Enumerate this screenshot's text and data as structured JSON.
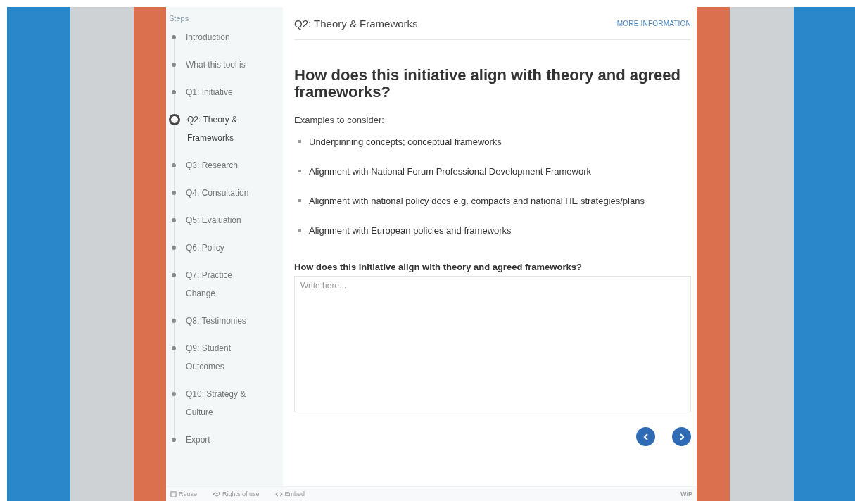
{
  "sidebar": {
    "title": "Steps",
    "steps": [
      {
        "label": "Introduction",
        "selected": false
      },
      {
        "label": "What this tool is",
        "selected": false
      },
      {
        "label": "Q1: Initiative",
        "selected": false
      },
      {
        "label": "Q2: Theory & Frameworks",
        "selected": true
      },
      {
        "label": "Q3: Research",
        "selected": false
      },
      {
        "label": "Q4: Consultation",
        "selected": false
      },
      {
        "label": "Q5: Evaluation",
        "selected": false
      },
      {
        "label": "Q6: Policy",
        "selected": false
      },
      {
        "label": "Q7: Practice Change",
        "selected": false
      },
      {
        "label": "Q8: Testimonies",
        "selected": false
      },
      {
        "label": "Q9: Student Outcomes",
        "selected": false
      },
      {
        "label": "Q10: Strategy & Culture",
        "selected": false
      },
      {
        "label": "Export",
        "selected": false
      }
    ]
  },
  "header": {
    "title": "Q2: Theory & Frameworks",
    "link": "MORE INFORMATION"
  },
  "question": "How does this initiative align with theory and agreed frameworks?",
  "intro": "Examples to consider:",
  "examples": [
    "Underpinning concepts; conceptual frameworks",
    "Alignment with National Forum Professional Development Framework",
    "Alignment with national policy docs e.g. compacts and national HE strategies/plans",
    "Alignment with European policies and frameworks"
  ],
  "answer": {
    "label": "How does this initiative align with theory and agreed frameworks?",
    "placeholder": "Write here..."
  },
  "footer": {
    "links": [
      "Reuse",
      "Rights of use",
      "Embed"
    ],
    "brand": "W/P"
  }
}
